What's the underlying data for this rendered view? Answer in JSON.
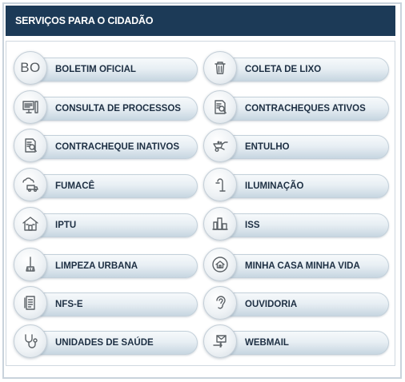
{
  "header": {
    "title": "SERVIÇOS PARA O CIDADÃO"
  },
  "services": [
    {
      "label": "BOLETIM OFICIAL",
      "icon": "bo-text-icon",
      "icon_text": "BO"
    },
    {
      "label": "COLETA DE LIXO",
      "icon": "trash-can-icon"
    },
    {
      "label": "CONSULTA DE PROCESSOS",
      "icon": "computer-monitor-icon"
    },
    {
      "label": "CONTRACHEQUES ATIVOS",
      "icon": "document-search-icon"
    },
    {
      "label": "CONTRACHEQUE INATIVOS",
      "icon": "document-search-icon"
    },
    {
      "label": "ENTULHO",
      "icon": "wheelbarrow-icon"
    },
    {
      "label": "FUMACÊ",
      "icon": "smoke-truck-icon"
    },
    {
      "label": "ILUMINAÇÃO",
      "icon": "street-lamp-icon"
    },
    {
      "label": "IPTU",
      "icon": "house-icon"
    },
    {
      "label": "ISS",
      "icon": "buildings-icon"
    },
    {
      "label": "LIMPEZA URBANA",
      "icon": "broom-icon"
    },
    {
      "label": "MINHA CASA MINHA VIDA",
      "icon": "home-circle-icon"
    },
    {
      "label": "NFS-E",
      "icon": "invoice-icon"
    },
    {
      "label": "OUVIDORIA",
      "icon": "ear-icon"
    },
    {
      "label": "UNIDADES DE SAÚDE",
      "icon": "stethoscope-icon"
    },
    {
      "label": "WEBMAIL",
      "icon": "email-icon"
    }
  ]
}
